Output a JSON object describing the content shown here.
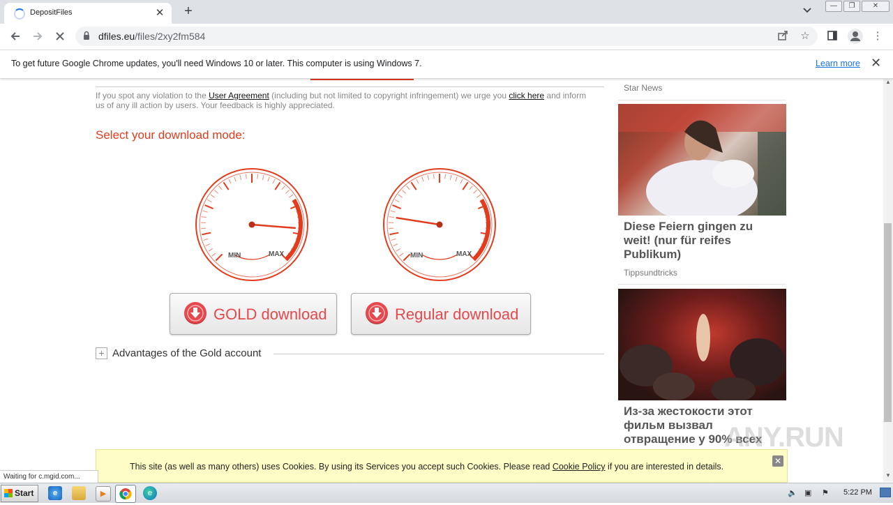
{
  "browser": {
    "tab_title": "DepositFiles",
    "tab_close": "✕",
    "new_tab": "+",
    "url_host": "dfiles.eu",
    "url_path": "/files/2xy2fm584",
    "window_minimize": "—",
    "window_restore": "❐",
    "window_close": "✕"
  },
  "infobar": {
    "message": "To get future Google Chrome updates, you'll need Windows 10 or later. This computer is using Windows 7.",
    "learn_more": "Learn more",
    "close": "✕"
  },
  "page": {
    "notice_prefix": "If you spot any violation to the",
    "notice_link1": "User Agreement",
    "notice_middle": "(including but not limited to copyright infringement) we urge you",
    "notice_link2": "click here",
    "notice_suffix": "and inform us of any ill action by users. Your feedback is highly appreciated.",
    "mode_title": "Select your download mode:",
    "gauges": [
      {
        "min_label": "MIN",
        "max_label": "MAX",
        "needle_level": 0.85
      },
      {
        "min_label": "MIN",
        "max_label": "MAX",
        "needle_level": 0.2
      }
    ],
    "gold_button": "GOLD download",
    "regular_button": "Regular download",
    "advantages_toggle": "+",
    "advantages_label": "Advantages of the Gold account",
    "accent_color": "#e23b1d"
  },
  "sidebar": {
    "top_source": "Star News",
    "ads": [
      {
        "title": "Diese Feiern gingen zu weit! (nur für reifes Publikum)",
        "source": "Tippsundtricks"
      },
      {
        "title": "Из-за жестокости этот фильм вызвал отвращение у 90% всех",
        "source": ""
      }
    ]
  },
  "cookie": {
    "text_before": "This site (as well as many others) uses Cookies. By using its Services you accept such Cookies. Please read",
    "link": "Cookie Policy",
    "text_after": "if you are interested in details.",
    "close": "✕"
  },
  "status": {
    "text": "Waiting for c.mgid.com..."
  },
  "watermark": "ANY.RUN",
  "taskbar": {
    "start": "Start",
    "clock": "5:22 PM"
  }
}
